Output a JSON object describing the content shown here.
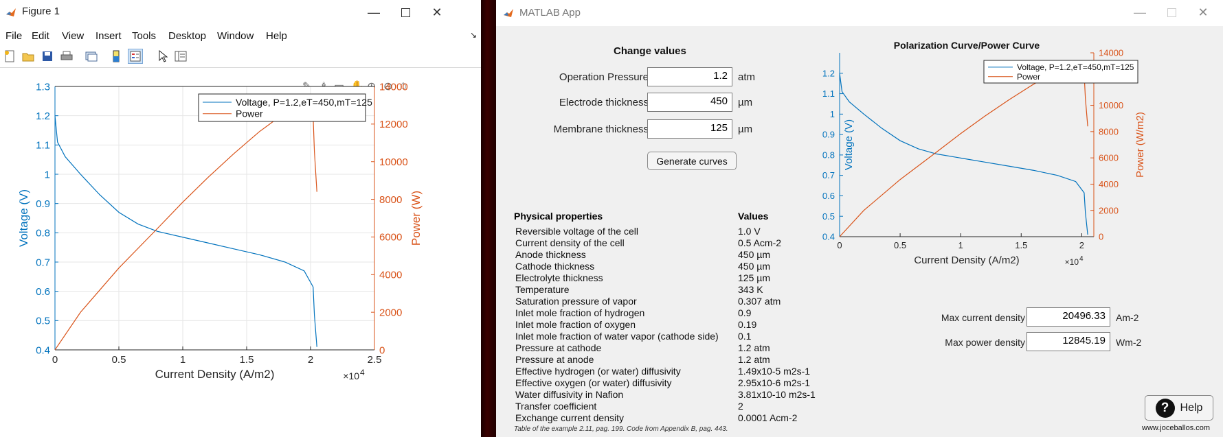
{
  "figure_window": {
    "title": "Figure 1",
    "menu": [
      "File",
      "Edit",
      "View",
      "Insert",
      "Tools",
      "Desktop",
      "Window",
      "Help"
    ],
    "toolbar_icons": [
      "new-file-icon",
      "open-folder-icon",
      "save-icon",
      "print-icon",
      "link-icon",
      "colorbar-icon",
      "legend-icon",
      "pointer-icon",
      "property-editor-icon"
    ],
    "axes_toolbar_icons": [
      "export-icon",
      "brush-icon",
      "datatip-icon",
      "pan-icon",
      "zoom-in-icon",
      "zoom-out-icon",
      "home-icon"
    ]
  },
  "app_window": {
    "title": "MATLAB App",
    "change_values": {
      "heading": "Change values",
      "fields": [
        {
          "label": "Operation Pressure",
          "value": "1.2",
          "unit": "atm"
        },
        {
          "label": "Electrode thickness",
          "value": "450",
          "unit": "µm"
        },
        {
          "label": "Membrane thickness",
          "value": "125",
          "unit": "µm"
        }
      ],
      "generate_label": "Generate curves"
    },
    "properties": {
      "header_name": "Physical properties",
      "header_value": "Values",
      "rows": [
        [
          "Reversible voltage of the cell",
          "1.0 V"
        ],
        [
          "Current density of the cell",
          "0.5 Acm-2"
        ],
        [
          "Anode thickness",
          "450 µm"
        ],
        [
          "Cathode thickness",
          "450 µm"
        ],
        [
          "Electrolyte thickness",
          "125 µm"
        ],
        [
          "Temperature",
          "343 K"
        ],
        [
          "Saturation pressure of vapor",
          "0.307 atm"
        ],
        [
          "Inlet mole fraction of hydrogen",
          "0.9"
        ],
        [
          "Inlet mole fraction of oxygen",
          "0.19"
        ],
        [
          "Inlet mole fraction of water vapor (cathode side)",
          "0.1"
        ],
        [
          "Pressure at cathode",
          "1.2 atm"
        ],
        [
          "Pressure at anode",
          "1.2 atm"
        ],
        [
          "Effective hydrogen (or water) diffusivity",
          "1.49x10-5 m2s-1"
        ],
        [
          "Effective oxygen (or water) diffusivity",
          "2.95x10-6 m2s-1"
        ],
        [
          "Water diffusivity in Nafion",
          "3.81x10-10 m2s-1"
        ],
        [
          "Transfer coefficient",
          "2"
        ],
        [
          "Exchange current density",
          "0.0001 Acm-2"
        ]
      ],
      "footnote": "Table of the example 2.11, pag. 199. Code from Appendix B, pag. 443."
    },
    "results": {
      "max_current_label": "Max current density",
      "max_current_value": "20496.33",
      "max_current_unit": "Am-2",
      "max_power_label": "Max power density",
      "max_power_value": "12845.19",
      "max_power_unit": "Wm-2"
    },
    "help_label": "Help",
    "website": "www.joceballos.com"
  },
  "chart_data": [
    {
      "type": "line",
      "title": "",
      "xlabel": "Current Density (A/m2)",
      "x_exponent": "×10",
      "x_exponent_power": "4",
      "ylabel_left": "Voltage  (V)",
      "ylabel_right": "Power  (W)",
      "xlim": [
        0,
        25000
      ],
      "ylim_left": [
        0.4,
        1.3
      ],
      "ylim_right": [
        0,
        14000
      ],
      "x_ticks": [
        "0",
        "0.5",
        "1",
        "1.5",
        "2",
        "2.5"
      ],
      "y_ticks_left": [
        "0.4",
        "0.5",
        "0.6",
        "0.7",
        "0.8",
        "0.9",
        "1",
        "1.1",
        "1.2",
        "1.3"
      ],
      "y_ticks_right": [
        "0",
        "2000",
        "4000",
        "6000",
        "8000",
        "10000",
        "12000",
        "14000"
      ],
      "grid": true,
      "legend": "top-right",
      "colors": {
        "voltage": "#0072BD",
        "power": "#D95319"
      },
      "series": [
        {
          "name": "Voltage, P=1.2,eT=450,mT=125",
          "axis": "left",
          "x": [
            0,
            200,
            800,
            2000,
            3500,
            5000,
            6500,
            8000,
            10000,
            12000,
            14000,
            16000,
            18000,
            19500,
            20200,
            20300,
            20496
          ],
          "y": [
            1.2,
            1.11,
            1.06,
            1.0,
            0.93,
            0.87,
            0.83,
            0.805,
            0.785,
            0.765,
            0.745,
            0.725,
            0.7,
            0.67,
            0.615,
            0.52,
            0.41
          ]
        },
        {
          "name": "Power",
          "axis": "left",
          "x": [
            0,
            2000,
            5000,
            8000,
            10000,
            12000,
            14000,
            16000,
            18000,
            19500,
            20200,
            20300,
            20496
          ],
          "y": [
            0,
            2000,
            4350,
            6440,
            7850,
            9180,
            10430,
            11600,
            12600,
            13060,
            12425,
            10560,
            8400
          ]
        }
      ]
    },
    {
      "type": "line",
      "title": "Polarization Curve/Power Curve",
      "xlabel": "Current  Density  (A/m2)",
      "x_exponent": "×10",
      "x_exponent_power": "4",
      "ylabel_left": "Voltage  (V)",
      "ylabel_right": "Power  (W/m2)",
      "xlim": [
        0,
        21000
      ],
      "ylim_left": [
        0.4,
        1.3
      ],
      "ylim_right": [
        0,
        14000
      ],
      "x_ticks": [
        "0",
        "0.5",
        "1",
        "1.5",
        "2"
      ],
      "y_ticks_left": [
        "0.4",
        "0.5",
        "0.6",
        "0.7",
        "0.8",
        "0.9",
        "1",
        "1.1",
        "1.2"
      ],
      "y_ticks_right": [
        "0",
        "2000",
        "4000",
        "6000",
        "8000",
        "10000",
        "12000",
        "14000"
      ],
      "grid": false,
      "legend": "top-left",
      "colors": {
        "voltage": "#0072BD",
        "power": "#D95319"
      },
      "series": [
        {
          "name": "Voltage, P=1.2,eT=450,mT=125",
          "axis": "left",
          "x": [
            0,
            200,
            800,
            2000,
            3500,
            5000,
            6500,
            8000,
            10000,
            12000,
            14000,
            16000,
            18000,
            19500,
            20200,
            20300,
            20496
          ],
          "y": [
            1.2,
            1.11,
            1.06,
            1.0,
            0.93,
            0.87,
            0.83,
            0.805,
            0.785,
            0.765,
            0.745,
            0.725,
            0.7,
            0.67,
            0.615,
            0.52,
            0.41
          ]
        },
        {
          "name": "Power",
          "axis": "left",
          "x": [
            0,
            2000,
            5000,
            8000,
            10000,
            12000,
            14000,
            16000,
            18000,
            19500,
            20200,
            20300,
            20496
          ],
          "y": [
            0,
            2000,
            4350,
            6440,
            7850,
            9180,
            10430,
            11600,
            12600,
            13060,
            12425,
            10560,
            8400
          ]
        }
      ]
    }
  ]
}
